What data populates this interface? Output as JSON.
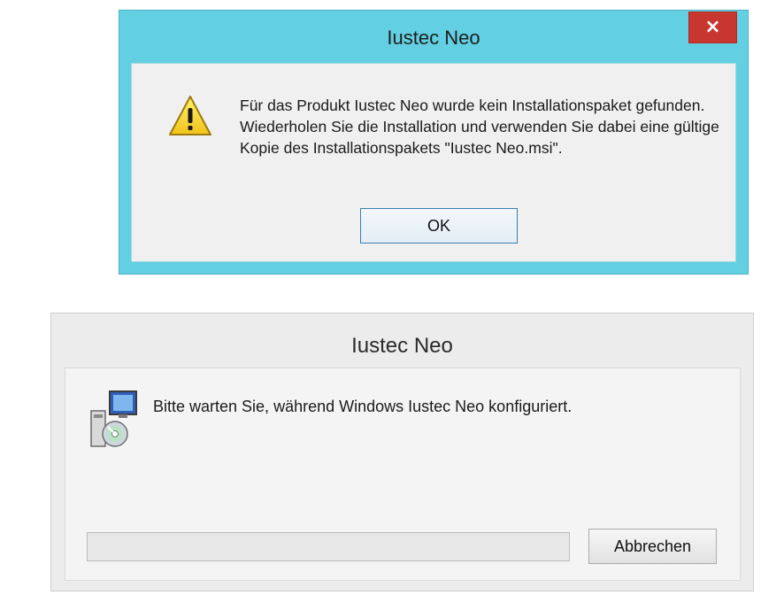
{
  "progress_dialog": {
    "title": "Iustec Neo",
    "message": "Bitte warten Sie, während Windows Iustec Neo konfiguriert.",
    "icon": "installer-package-icon",
    "progress_fraction": 0,
    "cancel_label": "Abbrechen"
  },
  "error_dialog": {
    "title": "Iustec Neo",
    "close_glyph": "×",
    "icon": "warning-icon",
    "message": "Für das Produkt Iustec Neo wurde kein Installationspaket gefunden. Wiederholen Sie die Installation und verwenden Sie dabei eine gültige Kopie des Installationspakets \"Iustec Neo.msi\".",
    "ok_label": "OK"
  },
  "colors": {
    "error_frame": "#62d0e2",
    "close_button": "#c7372f",
    "progress_frame": "#ececec",
    "client_bg": "#f0f0f0",
    "ok_border": "#3c7fb1"
  }
}
